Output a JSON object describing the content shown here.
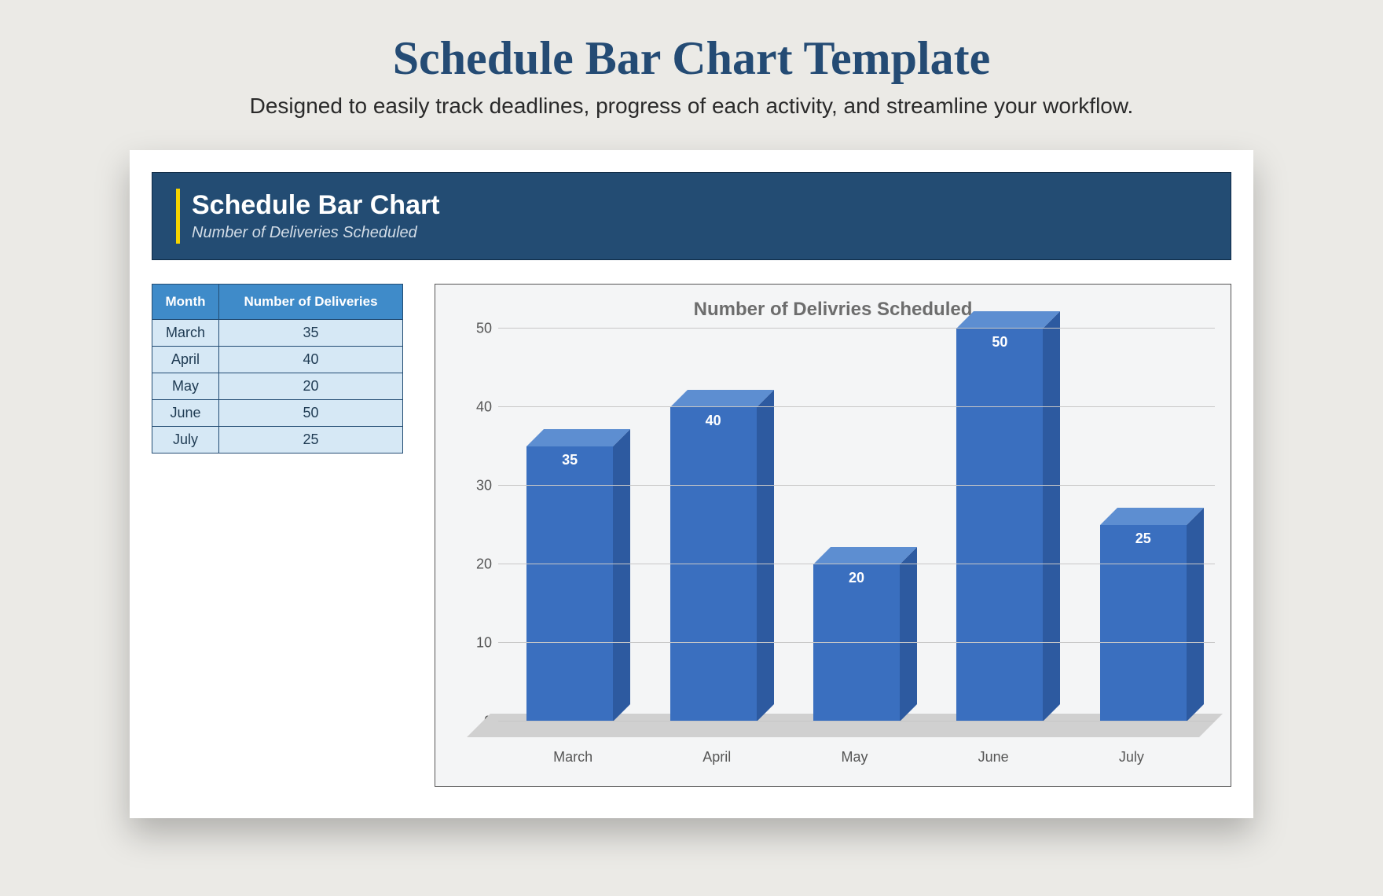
{
  "page": {
    "title": "Schedule Bar Chart Template",
    "subtitle": "Designed to easily track deadlines, progress of each activity, and streamline your workflow."
  },
  "card": {
    "title": "Schedule Bar Chart",
    "subtitle": "Number of Deliveries Scheduled"
  },
  "table": {
    "headers": {
      "month": "Month",
      "deliveries": "Number of Deliveries"
    },
    "rows": [
      {
        "month": "March",
        "deliveries": "35"
      },
      {
        "month": "April",
        "deliveries": "40"
      },
      {
        "month": "May",
        "deliveries": "20"
      },
      {
        "month": "June",
        "deliveries": "50"
      },
      {
        "month": "July",
        "deliveries": "25"
      }
    ]
  },
  "chart_data": {
    "type": "bar",
    "title": "Number of Delivries Scheduled",
    "categories": [
      "March",
      "April",
      "May",
      "June",
      "July"
    ],
    "values": [
      35,
      40,
      20,
      50,
      25
    ],
    "xlabel": "",
    "ylabel": "",
    "ylim": [
      0,
      50
    ],
    "yticks": [
      0,
      10,
      20,
      30,
      40,
      50
    ]
  },
  "colors": {
    "header_bg": "#234c73",
    "accent_yellow": "#f6d400",
    "table_header": "#3f8bc9",
    "table_cell": "#d6e8f5",
    "bar_front": "#3a6fbf",
    "bar_top": "#5d8ed1",
    "bar_side": "#2d5aa0"
  }
}
